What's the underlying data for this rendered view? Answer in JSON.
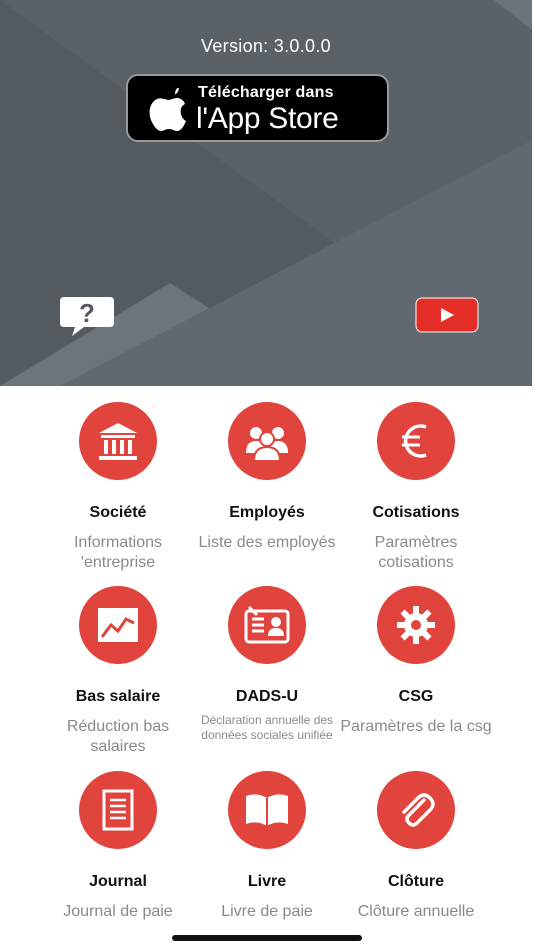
{
  "header": {
    "version_label": "Version: 3.0.0.0",
    "appstore_line1": "Télécharger dans",
    "appstore_line2": "l'App Store",
    "help_icon": "question-bubble-icon",
    "video_icon": "youtube-play-icon"
  },
  "tiles": [
    {
      "title": "Société",
      "desc": "Informations 'entreprise",
      "icon": "bank-building-icon"
    },
    {
      "title": "Employés",
      "desc": "Liste des employés",
      "icon": "people-group-icon"
    },
    {
      "title": "Cotisations",
      "desc": "Paramètres cotisations",
      "icon": "euro-icon"
    },
    {
      "title": "Bas salaire",
      "desc": "Réduction bas salaires",
      "icon": "chart-trend-icon"
    },
    {
      "title": "DADS-U",
      "desc": "Déclaration annuelle des données sociales unifiée",
      "icon": "id-card-icon"
    },
    {
      "title": "CSG",
      "desc": "Paramètres de la csg",
      "icon": "gear-icon"
    },
    {
      "title": "Journal",
      "desc": "Journal de paie",
      "icon": "document-icon"
    },
    {
      "title": "Livre",
      "desc": "Livre de paie",
      "icon": "open-book-icon"
    },
    {
      "title": "Clôture",
      "desc": "Clôture annuelle",
      "icon": "paperclip-icon"
    }
  ],
  "colors": {
    "hero_bg": "#535a60",
    "accent_red": "#e0443c",
    "youtube_red": "#e52d27"
  }
}
